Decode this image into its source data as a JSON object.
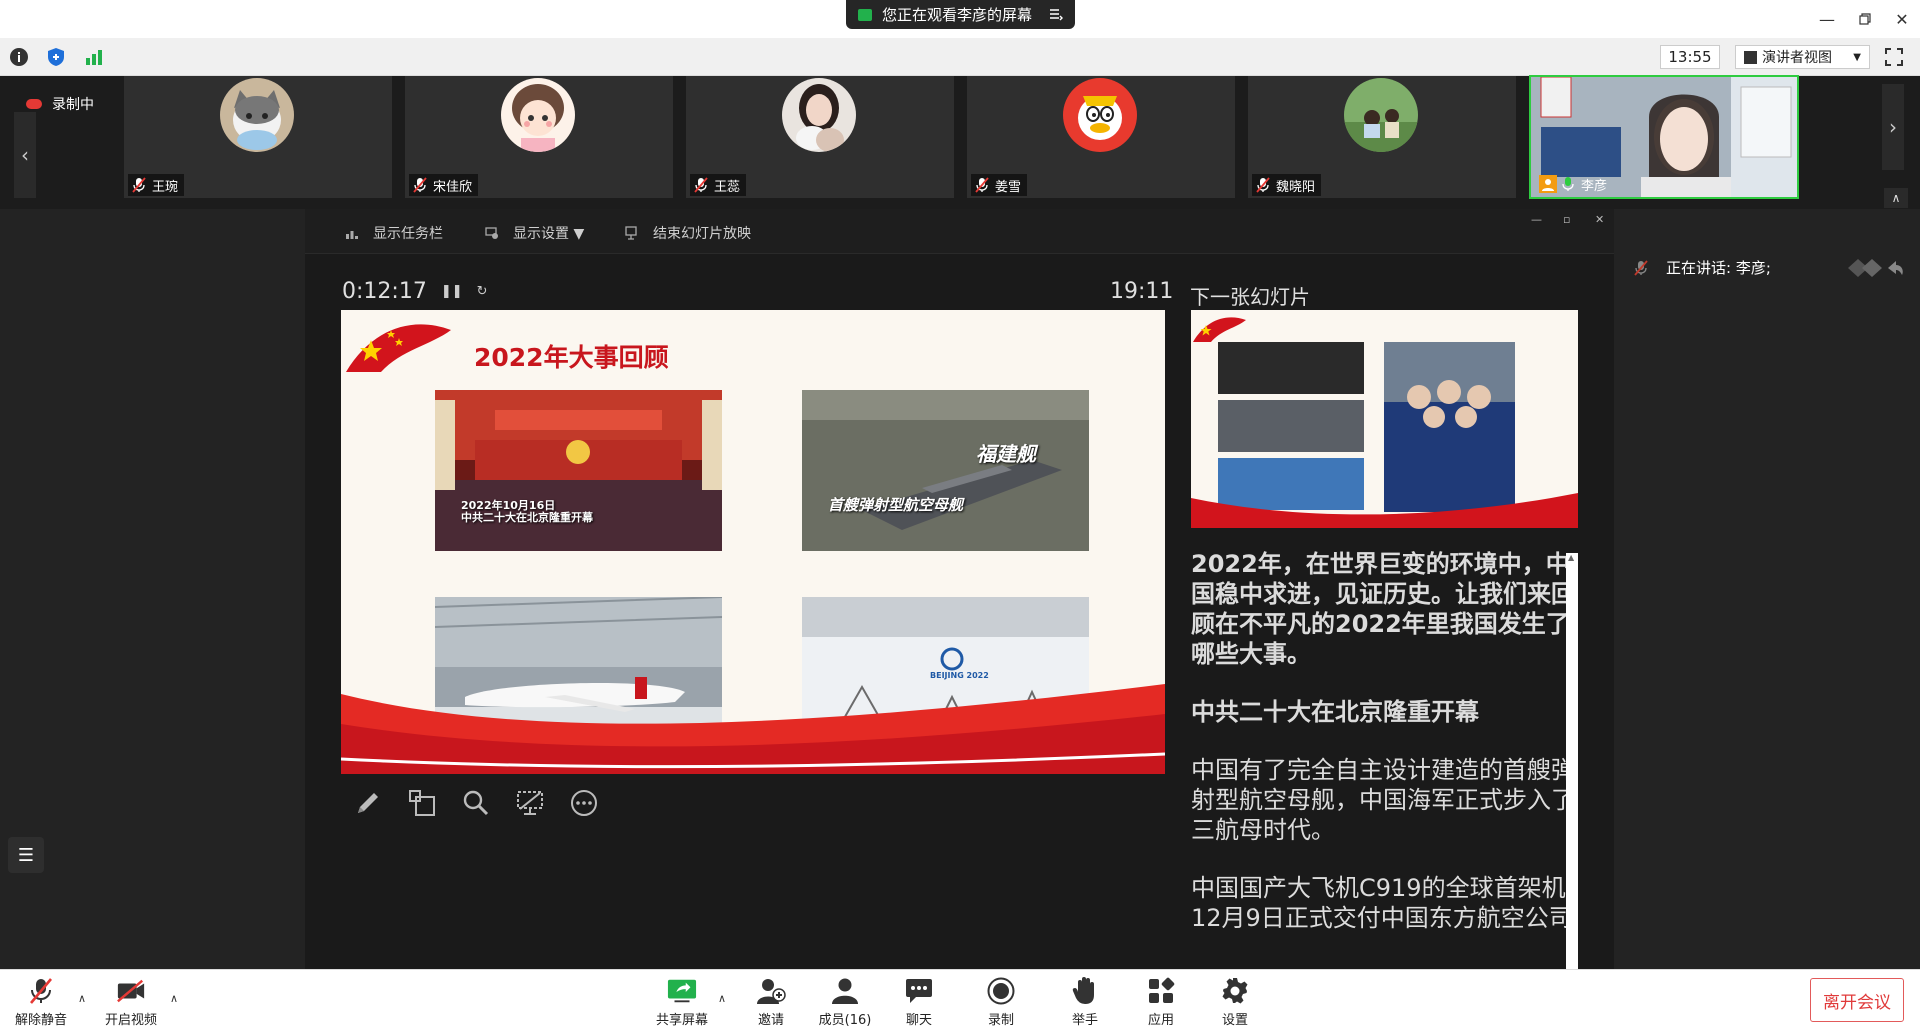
{
  "titlebar": {
    "viewing_text": "您正在观看李彦的屏幕"
  },
  "infobar": {
    "time": "13:55",
    "view_mode": "演讲者视图"
  },
  "recording": {
    "label": "录制中"
  },
  "participants": [
    {
      "name": "王琬"
    },
    {
      "name": "宋佳欣"
    },
    {
      "name": "王蕊"
    },
    {
      "name": "姜雪"
    },
    {
      "name": "魏晓阳"
    },
    {
      "name": "李彦"
    }
  ],
  "presenter_toolbar": {
    "show_taskbar": "显示任务栏",
    "display_settings": "显示设置 ▼",
    "end_slideshow": "结束幻灯片放映"
  },
  "presenter": {
    "elapsed": "0:12:17",
    "clock": "19:11",
    "next_slide_label": "下一张幻灯片"
  },
  "slide": {
    "title": "2022年大事回顾",
    "photo1_caption": "2022年10月16日\n中共二十大在北京隆重开幕",
    "photo2_caption": "福建舰",
    "photo2_sub": "首艘弹射型航空母舰",
    "photo4_logo": "BEIJING 2022"
  },
  "notes": [
    {
      "text": "2022年，在世界巨变的环境中，中国稳中求进，见证历史。让我们来回顾在不平凡的2022年里我国发生了哪些大事。",
      "bold": true
    },
    {
      "text": "中共二十大在北京隆重开幕",
      "bold": true
    },
    {
      "text": "中国有了完全自主设计建造的首艘弹射型航空母舰，中国海军正式步入了三航母时代。",
      "bold": false
    },
    {
      "text": "中国国产大飞机C919的全球首架机12月9日正式交付中国东方航空公司",
      "bold": false
    }
  ],
  "right_panel": {
    "speaking": "正在讲话: 李彦;"
  },
  "bottombar": {
    "unmute": "解除静音",
    "start_video": "开启视频",
    "share_screen": "共享屏幕",
    "invite": "邀请",
    "members": "成员(16)",
    "chat": "聊天",
    "record": "录制",
    "raise_hand": "举手",
    "apps": "应用",
    "settings": "设置",
    "leave": "离开会议"
  },
  "colors": {
    "accent_green": "#22b14c",
    "leave_red": "#e03a3a",
    "slide_red": "#c8161d"
  }
}
